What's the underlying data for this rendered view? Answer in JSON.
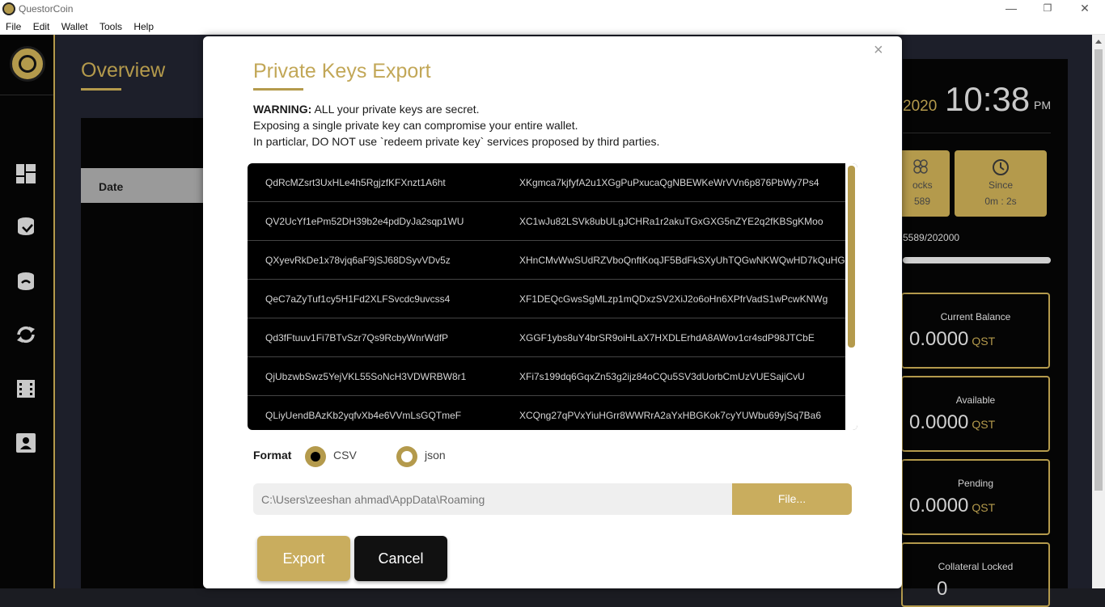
{
  "window": {
    "title": "QuestorCoin",
    "minimize_glyph": "—",
    "restore_glyph": "❐",
    "close_glyph": "✕"
  },
  "menu": [
    "File",
    "Edit",
    "Wallet",
    "Tools",
    "Help"
  ],
  "sidebar": {
    "icons": [
      "dashboard-icon",
      "send-coins-icon",
      "receive-coins-icon",
      "transactions-icon",
      "masternodes-icon",
      "address-book-icon"
    ]
  },
  "overview": {
    "title": "Overview",
    "date_header": "Date"
  },
  "right_panel": {
    "date_partial": "2020",
    "time": "10:38",
    "ampm": "PM",
    "blocks_label": "ocks",
    "blocks_value": "589",
    "since_label": "Since",
    "since_value": "0m : 2s",
    "sync_progress_text": "5589/202000",
    "balances": [
      {
        "label": "Current Balance",
        "value": "0.0000",
        "unit": "QST"
      },
      {
        "label": "Available",
        "value": "0.0000",
        "unit": "QST"
      },
      {
        "label": "Pending",
        "value": "0.0000",
        "unit": "QST"
      },
      {
        "label": "Collateral Locked",
        "value": "0",
        "unit": ""
      }
    ]
  },
  "modal": {
    "close_glyph": "×",
    "title": "Private Keys Export",
    "warning_bold": "WARNING:",
    "warning_rest": " ALL your private keys are secret.",
    "warning_line2": "Exposing a single private key can compromise your entire wallet.",
    "warning_line3": "In particlar, DO NOT use `redeem private key` services proposed by third parties.",
    "keys": [
      {
        "address": "QdRcMZsrt3UxHLe4h5RgjzfKFXnzt1A6ht",
        "key": "XKgmca7kjfyfA2u1XGgPuPxucaQgNBEWKeWrVVn6p876PbWy7Ps4"
      },
      {
        "address": "QV2UcYf1ePm52DH39b2e4pdDyJa2sqp1WU",
        "key": "XC1wJu82LSVk8ubULgJCHRa1r2akuTGxGXG5nZYE2q2fKBSgKMoo"
      },
      {
        "address": "QXyevRkDe1x78vjq6aF9jSJ68DSyvVDv5z",
        "key": "XHnCMvWwSUdRZVboQnftKoqJF5BdFkSXyUhTQGwNKWQwHD7kQuHG"
      },
      {
        "address": "QeC7aZyTuf1cy5H1Fd2XLFSvcdc9uvcss4",
        "key": "XF1DEQcGwsSgMLzp1mQDxzSV2XiJ2o6oHn6XPfrVadS1wPcwKNWg"
      },
      {
        "address": "Qd3fFtuuv1Fi7BTvSzr7Qs9RcbyWnrWdfP",
        "key": "XGGF1ybs8uY4brSR9oiHLaX7HXDLErhdA8AWov1cr4sdP98JTCbE"
      },
      {
        "address": "QjUbzwbSwz5YejVKL55SoNcH3VDWRBW8r1",
        "key": "XFi7s199dq6GqxZn53g2ijz84oCQu5SV3dUorbCmUzVUESajiCvU"
      },
      {
        "address": "QLiyUendBAzKb2yqfvXb4e6VVmLsGQTmeF",
        "key": "XCQng27qPVxYiuHGrr8WWRrA2aYxHBGKok7cyYUWbu69yjSq7Ba6"
      }
    ],
    "format_label": "Format",
    "format_options": [
      "CSV",
      "json"
    ],
    "format_selected": "CSV",
    "path_value": "C:\\Users\\zeeshan ahmad\\AppData\\Roaming",
    "file_button": "File...",
    "export_button": "Export",
    "cancel_button": "Cancel"
  },
  "colors": {
    "accent": "#b49a4c",
    "dark": "#050505",
    "content_bg": "#1d1f2a"
  }
}
